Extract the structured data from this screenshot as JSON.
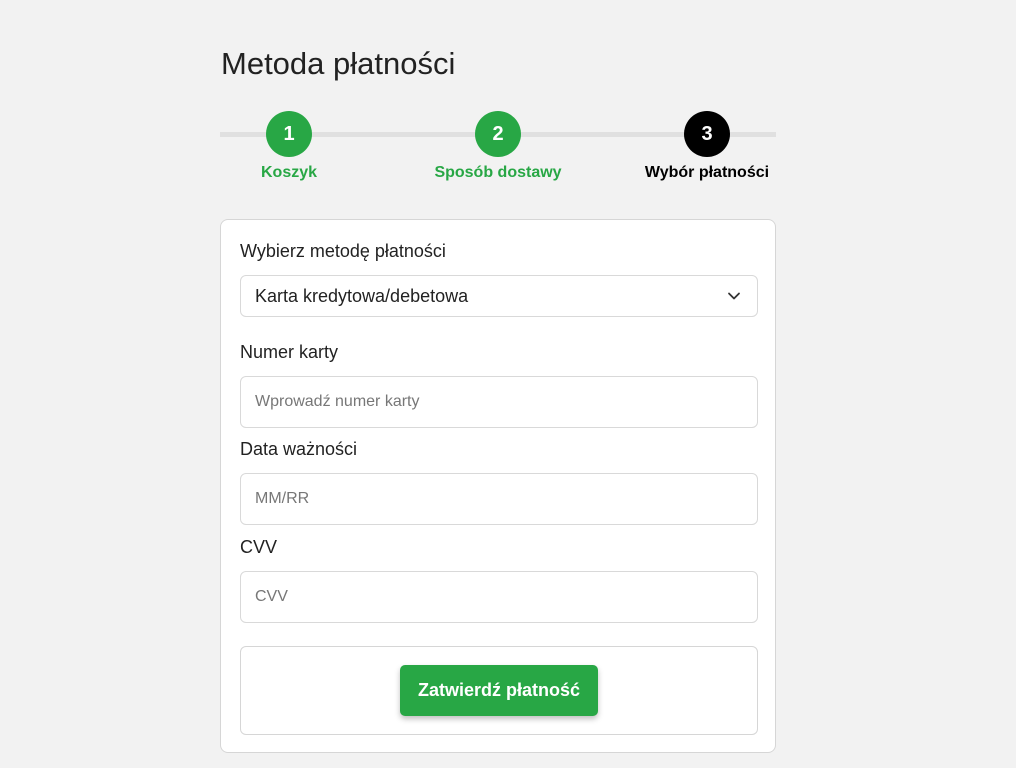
{
  "page": {
    "title": "Metoda płatności"
  },
  "stepper": {
    "steps": [
      {
        "number": "1",
        "label": "Koszyk",
        "state": "completed"
      },
      {
        "number": "2",
        "label": "Sposób dostawy",
        "state": "completed"
      },
      {
        "number": "3",
        "label": "Wybór płatności",
        "state": "active"
      }
    ],
    "colors": {
      "completed": "#28a745",
      "active": "#000000",
      "line": "#e0e0e0"
    }
  },
  "form": {
    "method_label": "Wybierz metodę płatności",
    "method_value": "Karta kredytowa/debetowa",
    "card_number_label": "Numer karty",
    "card_number_placeholder": "Wprowadź numer karty",
    "expiry_label": "Data ważności",
    "expiry_placeholder": "MM/RR",
    "cvv_label": "CVV",
    "cvv_placeholder": "CVV",
    "submit_label": "Zatwierdź płatność",
    "submit_color": "#28a745",
    "select_icon": "chevron-down-icon"
  }
}
